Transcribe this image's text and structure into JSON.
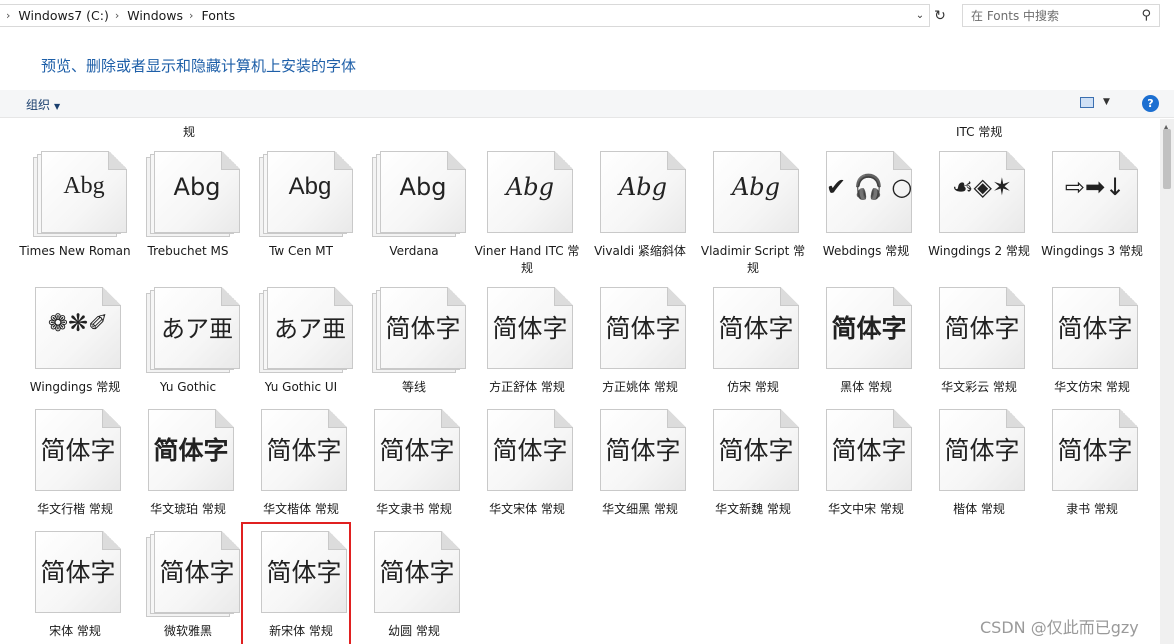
{
  "address": {
    "segments": [
      "Windows7 (C:)",
      "Windows",
      "Fonts"
    ],
    "search_placeholder": "在 Fonts 中搜索"
  },
  "heading": "预览、删除或者显示和隐藏计算机上安装的字体",
  "toolbar": {
    "organize": "组织"
  },
  "partial_labels": [
    "规",
    "ITC 常规"
  ],
  "fonts": [
    {
      "name": "Times New Roman",
      "sample": "Abg",
      "stack": true
    },
    {
      "name": "Trebuchet MS",
      "sample": "Abg",
      "stack": true
    },
    {
      "name": "Tw Cen MT",
      "sample": "Abg",
      "stack": true
    },
    {
      "name": "Verdana",
      "sample": "Abg",
      "stack": true
    },
    {
      "name": "Viner Hand ITC 常规",
      "sample": "Abg",
      "stack": false
    },
    {
      "name": "Vivaldi 紧缩斜体",
      "sample": "Abg",
      "stack": false
    },
    {
      "name": "Vladimir Script 常规",
      "sample": "Abg",
      "stack": false
    },
    {
      "name": "Webdings 常规",
      "sample": "✔ 🎧 ○",
      "stack": false
    },
    {
      "name": "Wingdings 2 常规",
      "sample": "☙◈✶",
      "stack": false
    },
    {
      "name": "Wingdings 3 常规",
      "sample": "⇨➡↓",
      "stack": false
    },
    {
      "name": "Wingdings 常规",
      "sample": "❁❋✐",
      "stack": false
    },
    {
      "name": "Yu Gothic",
      "sample": "あア亜",
      "stack": true
    },
    {
      "name": "Yu Gothic UI",
      "sample": "あア亜",
      "stack": true
    },
    {
      "name": "等线",
      "sample": "简体字",
      "stack": true
    },
    {
      "name": "方正舒体 常规",
      "sample": "简体字",
      "stack": false
    },
    {
      "name": "方正姚体 常规",
      "sample": "简体字",
      "stack": false
    },
    {
      "name": "仿宋 常规",
      "sample": "简体字",
      "stack": false
    },
    {
      "name": "黑体 常规",
      "sample": "简体字",
      "stack": false
    },
    {
      "name": "华文彩云 常规",
      "sample": "简体字",
      "stack": false
    },
    {
      "name": "华文仿宋 常规",
      "sample": "简体字",
      "stack": false
    },
    {
      "name": "华文行楷 常规",
      "sample": "简体字",
      "stack": false
    },
    {
      "name": "华文琥珀 常规",
      "sample": "简体字",
      "stack": false
    },
    {
      "name": "华文楷体 常规",
      "sample": "简体字",
      "stack": false
    },
    {
      "name": "华文隶书 常规",
      "sample": "简体字",
      "stack": false
    },
    {
      "name": "华文宋体 常规",
      "sample": "简体字",
      "stack": false
    },
    {
      "name": "华文细黑 常规",
      "sample": "简体字",
      "stack": false
    },
    {
      "name": "华文新魏 常规",
      "sample": "简体字",
      "stack": false
    },
    {
      "name": "华文中宋 常规",
      "sample": "简体字",
      "stack": false
    },
    {
      "name": "楷体 常规",
      "sample": "简体字",
      "stack": false
    },
    {
      "name": "隶书 常规",
      "sample": "简体字",
      "stack": false
    },
    {
      "name": "宋体 常规",
      "sample": "简体字",
      "stack": false
    },
    {
      "name": "微软雅黑",
      "sample": "简体字",
      "stack": true,
      "selected": true
    },
    {
      "name": "新宋体 常规",
      "sample": "简体字",
      "stack": false
    },
    {
      "name": "幼圆 常规",
      "sample": "简体字",
      "stack": false
    }
  ],
  "watermark": "CSDN @仅此而已gzy",
  "colors": {
    "heading": "#1e5fa8",
    "selection": "#e02020",
    "help": "#1c6fd1"
  }
}
